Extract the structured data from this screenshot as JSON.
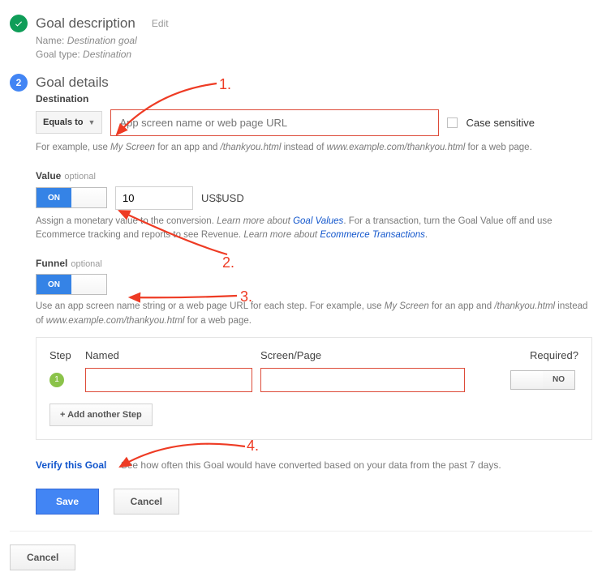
{
  "step1": {
    "title": "Goal description",
    "edit": "Edit",
    "name_label": "Name:",
    "name_value": "Destination goal",
    "type_label": "Goal type:",
    "type_value": "Destination"
  },
  "step2": {
    "num": "2",
    "title": "Goal details"
  },
  "destination": {
    "label": "Destination",
    "match_type": "Equals to",
    "placeholder": "App screen name or web page URL",
    "case_sensitive": "Case sensitive",
    "help_pre": "For example, use ",
    "help_app": "My Screen",
    "help_mid1": " for an app and ",
    "help_path": "/thankyou.html",
    "help_mid2": " instead of ",
    "help_full": "www.example.com/thankyou.html",
    "help_post": " for a web page."
  },
  "value": {
    "label": "Value",
    "optional": "optional",
    "toggle_on": "ON",
    "amount": "10",
    "currency": "US$USD",
    "help_pre": "Assign a monetary value to the conversion. ",
    "help_link1_pre": "Learn more about ",
    "help_link1": "Goal Values",
    "help_mid": ". For a transaction, turn the Goal Value off and use Ecommerce tracking and reports to see Revenue. ",
    "help_link2_pre": "Learn more about ",
    "help_link2": "Ecommerce Transactions",
    "help_post": "."
  },
  "funnel": {
    "label": "Funnel",
    "optional": "optional",
    "toggle_on": "ON",
    "help_pre": "Use an app screen name string or a web page URL for each step. For example, use ",
    "help_app": "My Screen",
    "help_mid1": " for an app and ",
    "help_path": "/thankyou.html",
    "help_mid2": " instead of ",
    "help_full": "www.example.com/thankyou.html",
    "help_post": " for a web page.",
    "col_step": "Step",
    "col_named": "Named",
    "col_screen": "Screen/Page",
    "col_required": "Required?",
    "step1_num": "1",
    "required_no": "NO",
    "add_step": "+ Add another Step"
  },
  "verify": {
    "link": "Verify this Goal",
    "text": "See how often this Goal would have converted based on your data from the past 7 days."
  },
  "buttons": {
    "save": "Save",
    "cancel": "Cancel",
    "footer_cancel": "Cancel"
  },
  "anno": {
    "a1": "1.",
    "a2": "2.",
    "a3": "3.",
    "a4": "4."
  }
}
